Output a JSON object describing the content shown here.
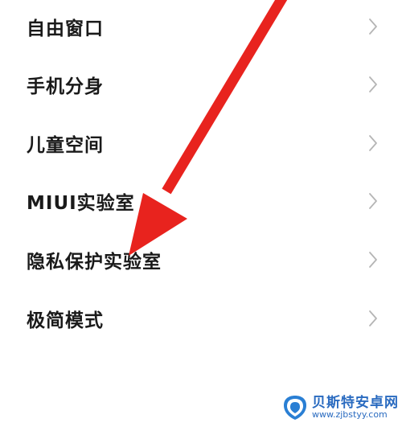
{
  "settings_list": {
    "items": [
      {
        "label": "自由窗口"
      },
      {
        "label": "手机分身"
      },
      {
        "label": "儿童空间"
      },
      {
        "label": "MIUI实验室"
      },
      {
        "label": "隐私保护实验室"
      },
      {
        "label": "极简模式"
      }
    ],
    "chevron_icon": "chevron-right-icon"
  },
  "annotation": {
    "arrow_color": "#e8231e",
    "points_to": "隐私保护实验室"
  },
  "watermark": {
    "name": "贝斯特安卓网",
    "url": "www.zjbstyy.com",
    "color": "#2a6bc0"
  }
}
